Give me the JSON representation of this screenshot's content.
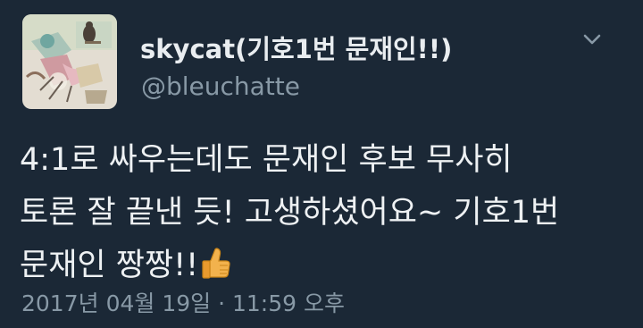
{
  "tweet": {
    "display_name": "skycat(기호1번 문재인!!)",
    "handle": "@bleuchatte",
    "body_lines": [
      "4:1로 싸우는데도 문재인 후보 무사히",
      "토론 잘 끝낸 듯! 고생하셨어요~ 기호1번",
      "문재인 짱짱!!"
    ],
    "timestamp": "2017년 04월 19일 · 11:59 오후"
  },
  "icons": {
    "menu": "chevron-down-icon",
    "emoji": "thumbs-up-icon"
  },
  "colors": {
    "background": "#1b2836",
    "name_text": "#e9edf0",
    "secondary_text": "#8899a6"
  }
}
